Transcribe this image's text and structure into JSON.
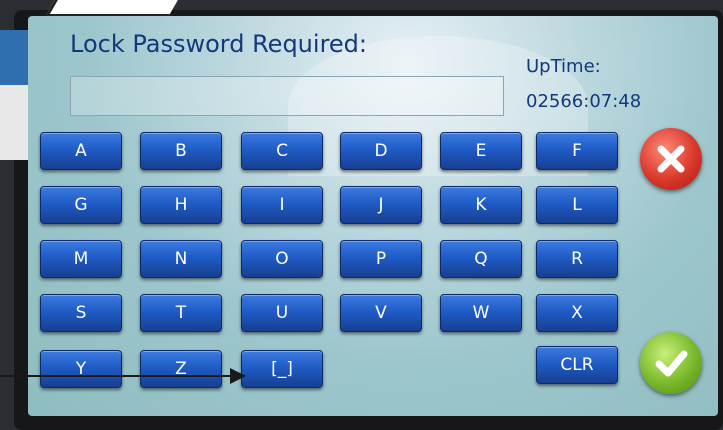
{
  "screen": {
    "title": "Lock Password Required:",
    "password_value": "",
    "uptime_label": "UpTime:",
    "uptime_value": "02566:07:48"
  },
  "keypad": {
    "rows": [
      [
        "A",
        "B",
        "C",
        "D",
        "E",
        "F"
      ],
      [
        "G",
        "H",
        "I",
        "J",
        "K",
        "L"
      ],
      [
        "M",
        "N",
        "O",
        "P",
        "Q",
        "R"
      ],
      [
        "S",
        "T",
        "U",
        "V",
        "W",
        "X"
      ],
      [
        "Y",
        "Z",
        "[_]"
      ]
    ],
    "clear_label": "CLR"
  },
  "actions": {
    "cancel_icon": "close-icon",
    "confirm_icon": "checkmark-icon"
  },
  "colors": {
    "key_blue": "#1f5cc6",
    "text_navy": "#123a7a",
    "cancel_red": "#d9382a",
    "confirm_green": "#79b82a"
  }
}
